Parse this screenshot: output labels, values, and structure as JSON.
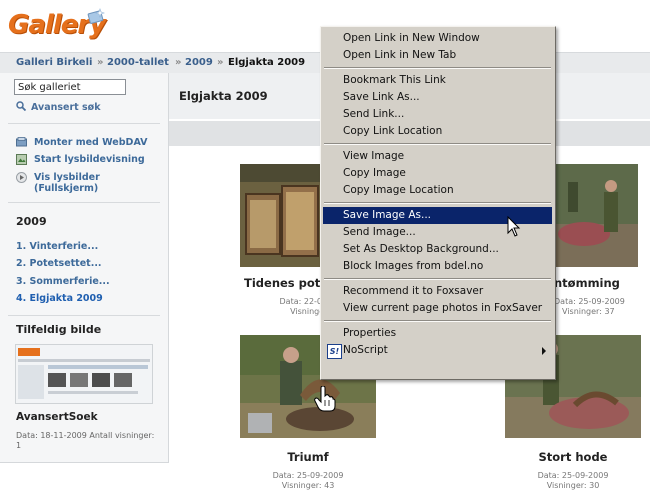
{
  "logo": {
    "text": "Gallery"
  },
  "breadcrumb": [
    {
      "label": "Galleri Birkeli",
      "current": false
    },
    {
      "label": "2000-tallet",
      "current": false
    },
    {
      "label": "2009",
      "current": false
    },
    {
      "label": "Elgjakta 2009",
      "current": true
    }
  ],
  "breadcrumb_sep": "»",
  "sidebar": {
    "search_value": "Søk galleriet",
    "advanced_search": "Avansert søk",
    "actions": [
      {
        "label": "Monter med WebDAV",
        "icon": "webdav-icon"
      },
      {
        "label": "Start lysbildevisning",
        "icon": "slideshow-icon"
      },
      {
        "label": "Vis lysbilder\n(Fullskjerm)",
        "icon": "play-icon"
      }
    ],
    "year_heading": "2009",
    "albums": [
      {
        "label": "1. Vinterferie...",
        "current": false
      },
      {
        "label": "2. Potetsettet...",
        "current": false
      },
      {
        "label": "3. Sommerferie...",
        "current": false
      },
      {
        "label": "4. Elgjakta 2009",
        "current": true
      }
    ],
    "random_heading": "Tilfeldig bilde",
    "random_title": "AvansertSoek",
    "random_meta": "Data: 18-11-2009 Antall visninger: 1"
  },
  "album": {
    "title": "Elgjakta 2009"
  },
  "photos": [
    {
      "caption": "Tidenes pot",
      "date_line": "Data: 22-09-",
      "views_line": "Visninger:"
    },
    {
      "caption": "ntømming",
      "date_line": "Data: 25-09-2009",
      "views_line": "Visninger: 37"
    },
    {
      "caption": "Triumf",
      "date_line": "Data: 25-09-2009",
      "views_line": "Visninger: 43"
    },
    {
      "caption": "Stort hode",
      "date_line": "Data: 25-09-2009",
      "views_line": "Visninger: 30"
    }
  ],
  "context_menu": {
    "items": [
      {
        "label": "Open Link in New Window"
      },
      {
        "label": "Open Link in New Tab"
      },
      {
        "sep": true
      },
      {
        "label": "Bookmark This Link"
      },
      {
        "label": "Save Link As..."
      },
      {
        "label": "Send Link..."
      },
      {
        "label": "Copy Link Location"
      },
      {
        "sep": true
      },
      {
        "label": "View Image"
      },
      {
        "label": "Copy Image"
      },
      {
        "label": "Copy Image Location"
      },
      {
        "sep": true
      },
      {
        "label": "Save Image As...",
        "highlighted": true
      },
      {
        "label": "Send Image..."
      },
      {
        "label": "Set As Desktop Background..."
      },
      {
        "label": "Block Images from bdel.no"
      },
      {
        "sep": true
      },
      {
        "label": "Recommend it to Foxsaver"
      },
      {
        "label": "View current page photos in FoxSaver"
      },
      {
        "sep": true
      },
      {
        "label": "Properties"
      },
      {
        "label": "NoScript",
        "submenu": true,
        "icon": "noscript-icon",
        "icon_text": "S!"
      }
    ]
  },
  "colors": {
    "accent": "#e5701c",
    "link": "#3d6a9a",
    "menu_bg": "#d4d0c8",
    "menu_highlight": "#0a246a"
  }
}
